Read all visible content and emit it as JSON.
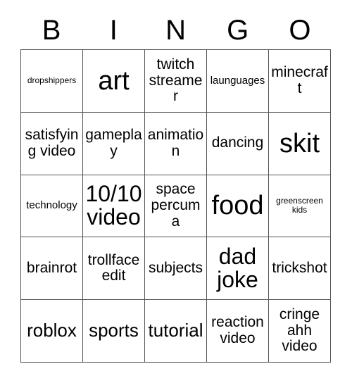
{
  "card": {
    "header_letters": [
      "B",
      "I",
      "N",
      "G",
      "O"
    ],
    "colors": {
      "background": "#ffffff",
      "text": "#000000",
      "grid_line": "#555555"
    },
    "grid": {
      "columns": 5,
      "rows": 5,
      "cells": [
        {
          "label": "dropshippers",
          "size": "xxs"
        },
        {
          "label": "art",
          "size": "xxl"
        },
        {
          "label": "twitch streamer",
          "size": "m"
        },
        {
          "label": "launguages",
          "size": "xs"
        },
        {
          "label": "minecraft",
          "size": "m"
        },
        {
          "label": "satisfying video",
          "size": "m"
        },
        {
          "label": "gameplay",
          "size": "m"
        },
        {
          "label": "animation",
          "size": "m"
        },
        {
          "label": "dancing",
          "size": "m"
        },
        {
          "label": "skit",
          "size": "xxl"
        },
        {
          "label": "technology",
          "size": "xs"
        },
        {
          "label": "10/10 video",
          "size": "xl"
        },
        {
          "label": "space percuma",
          "size": "m"
        },
        {
          "label": "food",
          "size": "xxl"
        },
        {
          "label": "greenscreen kids",
          "size": "xxs"
        },
        {
          "label": "brainrot",
          "size": "m"
        },
        {
          "label": "trollface edit",
          "size": "m"
        },
        {
          "label": "subjects",
          "size": "m"
        },
        {
          "label": "dad joke",
          "size": "xl"
        },
        {
          "label": "trickshot",
          "size": "m"
        },
        {
          "label": "roblox",
          "size": "l"
        },
        {
          "label": "sports",
          "size": "l"
        },
        {
          "label": "tutorial",
          "size": "l"
        },
        {
          "label": "reaction video",
          "size": "m"
        },
        {
          "label": "cringe ahh video",
          "size": "m"
        }
      ]
    }
  }
}
